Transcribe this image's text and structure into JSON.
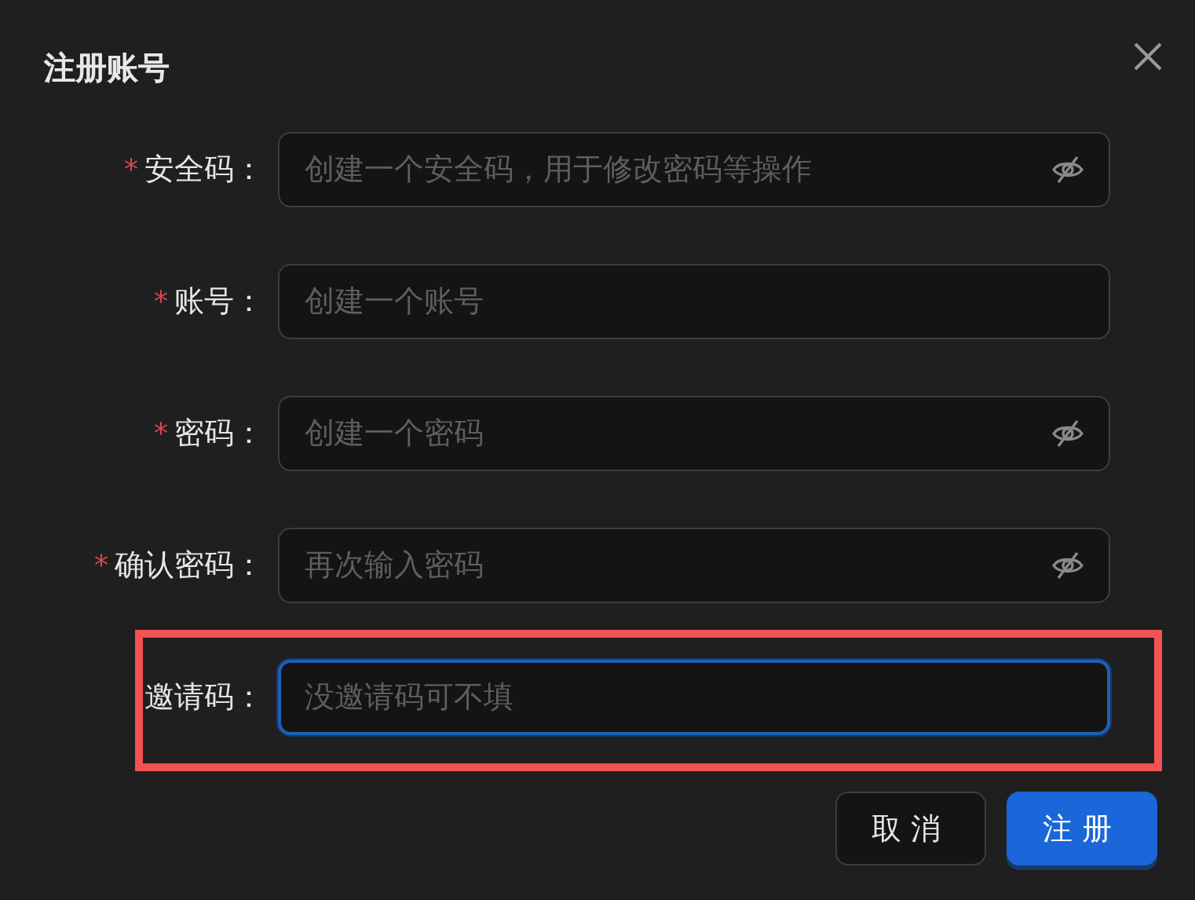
{
  "dialog": {
    "title": "注册账号"
  },
  "fields": [
    {
      "label": "安全码：",
      "marker": "*",
      "placeholder": "创建一个安全码，用于修改密码等操作",
      "password": true,
      "focused": false,
      "highlighted": false
    },
    {
      "label": "账号：",
      "marker": "*",
      "placeholder": "创建一个账号",
      "password": false,
      "focused": false,
      "highlighted": false
    },
    {
      "label": "密码：",
      "marker": "*",
      "placeholder": "创建一个密码",
      "password": true,
      "focused": false,
      "highlighted": false
    },
    {
      "label": "确认密码：",
      "marker": "*",
      "placeholder": "再次输入密码",
      "password": true,
      "focused": false,
      "highlighted": false
    },
    {
      "label": "邀请码：",
      "placeholder": "没邀请码可不填",
      "password": false,
      "focused": true,
      "highlighted": true
    }
  ],
  "buttons": [
    {
      "label": "取消",
      "kind": "secondary"
    },
    {
      "label": "注册",
      "kind": "primary"
    }
  ]
}
